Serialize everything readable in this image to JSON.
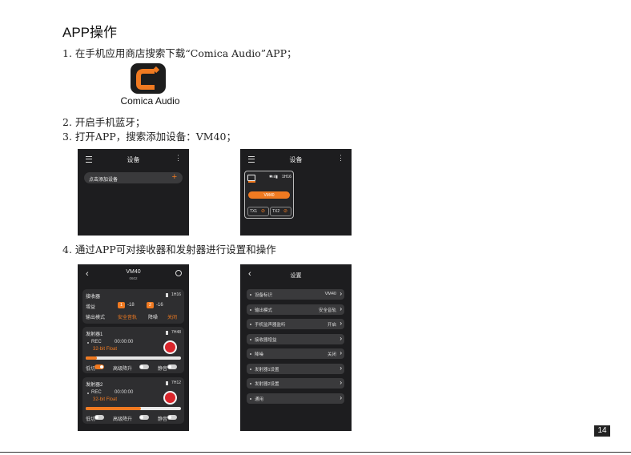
{
  "heading": "APP操作",
  "steps": [
    "1. 在手机应用商店搜索下载“Comica Audio”APP；",
    "2. 开启手机蓝牙；",
    "3. 打开APP，搜索添加设备：VM40；",
    "4. 通过APP可对接收器和发射器进行设置和操作"
  ],
  "logo_caption": "Comica Audio",
  "screen1": {
    "title": "设备",
    "add_device": "点击添加设备",
    "plus": "+"
  },
  "screen2": {
    "title": "设备",
    "battery": "1H16",
    "device": "VM40",
    "tx1": "TX1",
    "tx2": "TX2"
  },
  "screen3": {
    "title": "VM40",
    "subtitle": "0602",
    "receiver": {
      "label": "接收器",
      "battery": "1H16",
      "gain_label": "增益",
      "ch1": "1",
      "ch1_val": "-18",
      "ch2": "2",
      "ch2_val": "-16",
      "mode_label": "输出模式",
      "mode_val": "安全音轨",
      "noise_label": "降噪",
      "noise_val": "关闭"
    },
    "tx1": {
      "label": "发射器1",
      "battery": "7H48",
      "rec": "REC",
      "time": "00:00:00",
      "format": "32-bit Float",
      "low_cut": "低切",
      "auto_gain": "高级降升",
      "mute": "静音",
      "level": 0.12
    },
    "tx2": {
      "label": "发射器2",
      "battery": "7H12",
      "rec": "REC",
      "time": "00:00:00",
      "format": "32-bit Float",
      "low_cut": "低切",
      "auto_gain": "高级降升",
      "mute": "静音",
      "level": 0.58
    }
  },
  "screen4": {
    "title": "设置",
    "rows": [
      {
        "label": "设备标识",
        "value": "VM40"
      },
      {
        "label": "输出模式",
        "value": "安全音轨"
      },
      {
        "label": "手机监声器监听",
        "value": "开启"
      },
      {
        "label": "接收器增益",
        "value": ""
      },
      {
        "label": "降噪",
        "value": "关闭"
      },
      {
        "label": "发射器1设置",
        "value": ""
      },
      {
        "label": "发射器2设置",
        "value": ""
      },
      {
        "label": "通用",
        "value": ""
      }
    ]
  },
  "page_number": "14"
}
